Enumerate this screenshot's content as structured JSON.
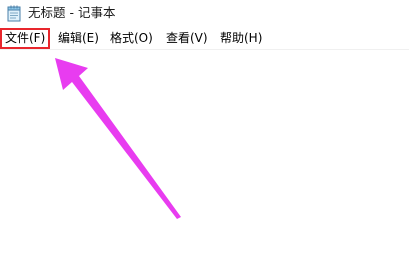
{
  "window": {
    "title": "无标题 - 记事本",
    "icon": "notepad-icon"
  },
  "menu": {
    "items": [
      {
        "label": "文件(F)",
        "highlighted": true
      },
      {
        "label": "编辑(E)",
        "highlighted": false
      },
      {
        "label": "格式(O)",
        "highlighted": false
      },
      {
        "label": "查看(V)",
        "highlighted": false
      },
      {
        "label": "帮助(H)",
        "highlighted": false
      }
    ]
  },
  "editor": {
    "content": ""
  },
  "annotation": {
    "highlight_color": "#e8262d",
    "arrow_color": "#e83cf0",
    "arrow_icon": "arrow-up-left-icon"
  }
}
